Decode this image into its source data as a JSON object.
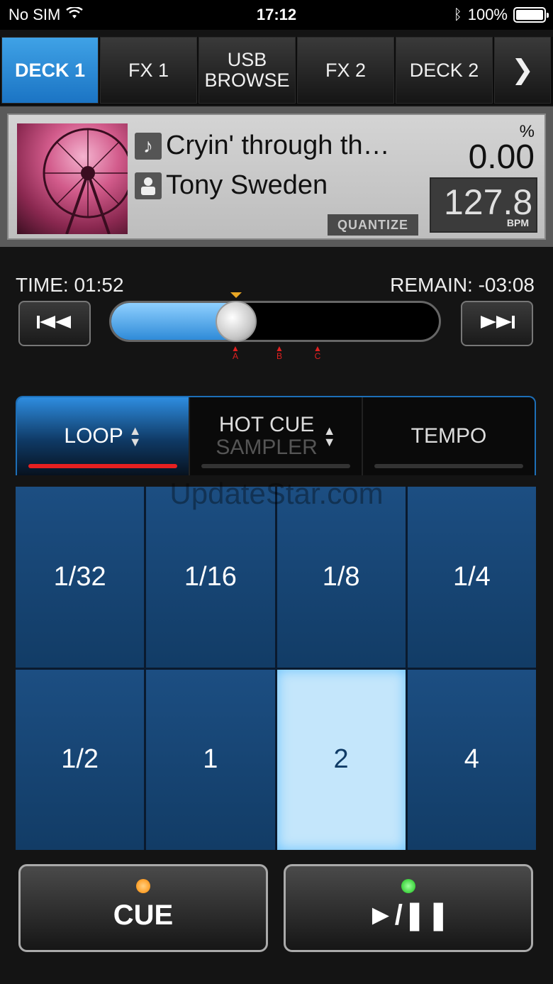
{
  "status": {
    "carrier": "No SIM",
    "time": "17:12",
    "battery": "100%"
  },
  "tabs": [
    {
      "label": "DECK 1"
    },
    {
      "label": "FX 1"
    },
    {
      "label": "USB\nBROWSE"
    },
    {
      "label": "FX 2"
    },
    {
      "label": "DECK 2"
    },
    {
      "label": "❯"
    }
  ],
  "track": {
    "title": "Cryin' through th…",
    "artist": "Tony Sweden",
    "quantize": "QUANTIZE",
    "pitch_unit": "%",
    "pitch_value": "0.00",
    "bpm_value": "127.8",
    "bpm_unit": "BPM"
  },
  "playback": {
    "time": "TIME: 01:52",
    "remain": "REMAIN: -03:08",
    "progress": 0.37,
    "cue_markers": [
      "A",
      "B",
      "C"
    ]
  },
  "modes": {
    "loop": "LOOP",
    "hotcue": "HOT CUE",
    "sampler": "SAMPLER",
    "tempo": "TEMPO"
  },
  "pads": [
    "1/32",
    "1/16",
    "1/8",
    "1/4",
    "1/2",
    "1",
    "2",
    "4"
  ],
  "active_pad": 6,
  "watermark": "UpdateStar.com",
  "transport": {
    "cue": "CUE",
    "play": "►/❚❚"
  },
  "colors": {
    "accent": "#2a8be0",
    "led_cue": "#ff8a00",
    "led_play": "#16c016",
    "loop_bar": "#e62020"
  }
}
